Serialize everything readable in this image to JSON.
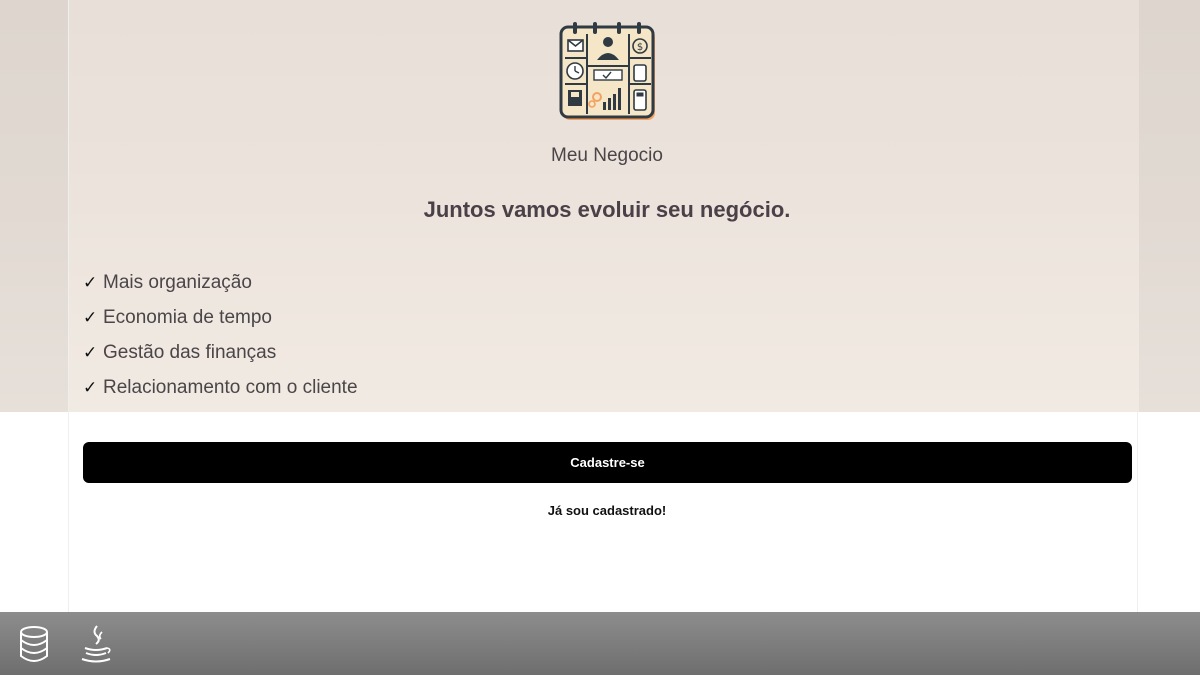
{
  "app": {
    "name": "Meu Negocio",
    "headline": "Juntos vamos evoluir seu negócio."
  },
  "features": [
    "Mais organização",
    "Economia de tempo",
    "Gestão das finanças",
    "Relacionamento com o cliente"
  ],
  "actions": {
    "signup_label": "Cadastre-se",
    "login_label": "Já sou cadastrado!"
  },
  "taskbar": {
    "icons": [
      "database-icon",
      "java-icon"
    ]
  },
  "colors": {
    "hero_background": "#e9e1d9",
    "primary_button": "#000000",
    "text": "#4a4548",
    "taskbar": "#7c7c7c"
  }
}
